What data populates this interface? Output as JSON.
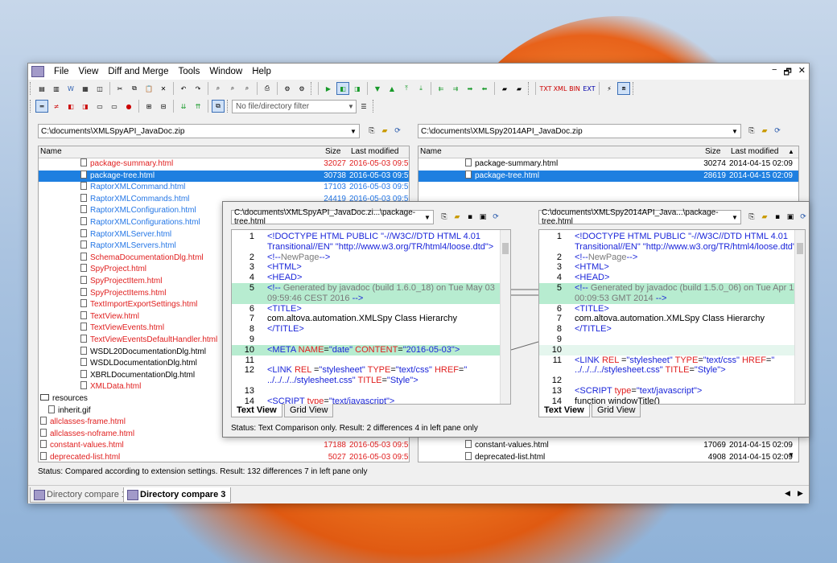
{
  "menu": [
    "File",
    "View",
    "Diff and Merge",
    "Tools",
    "Window",
    "Help"
  ],
  "window_controls": [
    "−",
    "🗗",
    "✕"
  ],
  "filter_placeholder": "No file/directory filter",
  "left_path": "C:\\documents\\XMLSpyAPI_JavaDoc.zip",
  "right_path": "C:\\documents\\XMLSpy2014API_JavaDoc.zip",
  "columns": {
    "name": "Name",
    "size": "Size",
    "modified": "Last modified"
  },
  "left_rows": [
    {
      "name": "package-summary.html",
      "size": "32027",
      "date": "2016-05-03 09:59",
      "color": "red",
      "indent": 1
    },
    {
      "name": "package-tree.html",
      "size": "30738",
      "date": "2016-05-03 09:59",
      "color": "sel",
      "indent": 1
    },
    {
      "name": "RaptorXMLCommand.html",
      "size": "17103",
      "date": "2016-05-03 09:59",
      "color": "blue",
      "indent": 1
    },
    {
      "name": "RaptorXMLCommands.html",
      "size": "24419",
      "date": "2016-05-03 09:59",
      "color": "blue",
      "indent": 1
    },
    {
      "name": "RaptorXMLConfiguration.html",
      "size": "",
      "date": "",
      "color": "blue",
      "indent": 1
    },
    {
      "name": "RaptorXMLConfigurations.html",
      "size": "",
      "date": "",
      "color": "blue",
      "indent": 1
    },
    {
      "name": "RaptorXMLServer.html",
      "size": "",
      "date": "",
      "color": "blue",
      "indent": 1
    },
    {
      "name": "RaptorXMLServers.html",
      "size": "",
      "date": "",
      "color": "blue",
      "indent": 1
    },
    {
      "name": "SchemaDocumentationDlg.html",
      "size": "",
      "date": "",
      "color": "red",
      "indent": 1
    },
    {
      "name": "SpyProject.html",
      "size": "",
      "date": "",
      "color": "red",
      "indent": 1
    },
    {
      "name": "SpyProjectItem.html",
      "size": "",
      "date": "",
      "color": "red",
      "indent": 1
    },
    {
      "name": "SpyProjectItems.html",
      "size": "",
      "date": "",
      "color": "red",
      "indent": 1
    },
    {
      "name": "TextImportExportSettings.html",
      "size": "",
      "date": "",
      "color": "red",
      "indent": 1
    },
    {
      "name": "TextView.html",
      "size": "",
      "date": "",
      "color": "red",
      "indent": 1
    },
    {
      "name": "TextViewEvents.html",
      "size": "",
      "date": "",
      "color": "red",
      "indent": 1
    },
    {
      "name": "TextViewEventsDefaultHandler.html",
      "size": "",
      "date": "",
      "color": "red",
      "indent": 1
    },
    {
      "name": "WSDL20DocumentationDlg.html",
      "size": "",
      "date": "",
      "color": "blk",
      "indent": 1
    },
    {
      "name": "WSDLDocumentationDlg.html",
      "size": "",
      "date": "",
      "color": "blk",
      "indent": 1
    },
    {
      "name": "XBRLDocumentationDlg.html",
      "size": "",
      "date": "",
      "color": "blk",
      "indent": 1
    },
    {
      "name": "XMLData.html",
      "size": "",
      "date": "",
      "color": "red",
      "indent": 1
    },
    {
      "name": "resources",
      "size": "",
      "date": "",
      "color": "dir",
      "indent": 0
    },
    {
      "name": "inherit.gif",
      "size": "",
      "date": "",
      "color": "blk",
      "indent": 0.5
    },
    {
      "name": "allclasses-frame.html",
      "size": "",
      "date": "",
      "color": "red",
      "indent": 0
    },
    {
      "name": "allclasses-noframe.html",
      "size": "",
      "date": "",
      "color": "red",
      "indent": 0
    },
    {
      "name": "constant-values.html",
      "size": "17188",
      "date": "2016-05-03 09:59",
      "color": "red",
      "indent": 0
    },
    {
      "name": "deprecated-list.html",
      "size": "5027",
      "date": "2016-05-03 09:59",
      "color": "red",
      "indent": 0
    }
  ],
  "right_rows": [
    {
      "name": "package-summary.html",
      "size": "30274",
      "date": "2014-04-15 02:09",
      "color": "blk"
    },
    {
      "name": "package-tree.html",
      "size": "28619",
      "date": "2014-04-15 02:09",
      "color": "sel"
    },
    {
      "name": "constant-values.html",
      "size": "17069",
      "date": "2014-04-15 02:09",
      "color": "blk"
    },
    {
      "name": "deprecated-list.html",
      "size": "4908",
      "date": "2014-04-15 02:09",
      "color": "blk"
    }
  ],
  "dir_status": "Status: Compared according to extension settings. Result: 132 differences 7 in left pane only",
  "tabs": [
    "Directory compare 1",
    "Directory compare 3"
  ],
  "text_compare": {
    "left_path": "C:\\documents\\XMLSpyAPI_JavaDoc.zi...\\package-tree.html",
    "right_path": "C:\\documents\\XMLSpy2014API_Java...\\package-tree.html",
    "view_tabs": [
      "Text View",
      "Grid View"
    ],
    "status": "Status: Text Comparison only. Result: 2 differences 4 in left pane only",
    "left_lines": [
      {
        "n": "1",
        "html": "<span class='tag'>&lt;!DOCTYPE HTML PUBLIC \"-//W3C//DTD HTML 4.01</span>"
      },
      {
        "n": "",
        "html": "<span class='tag'>Transitional//EN\" \"http://www.w3.org/TR/html4/loose.dtd\"&gt;</span>"
      },
      {
        "n": "2",
        "html": "<span class='tag'>&lt;!--</span><span class='cmt'>NewPage</span><span class='tag'>--&gt;</span>"
      },
      {
        "n": "3",
        "html": "<span class='tag'>&lt;HTML&gt;</span>"
      },
      {
        "n": "4",
        "html": "<span class='tag'>&lt;HEAD&gt;</span>"
      },
      {
        "n": "5",
        "html": "<span class='tag'>&lt;!--</span><span class='cmt'> Generated by javadoc (build 1.6.0_18) on Tue May 03</span>",
        "diff": true
      },
      {
        "n": "",
        "html": "<span class='cmt'>09:59:46 CEST 2016 </span><span class='tag'>--&gt;</span>",
        "diff": true
      },
      {
        "n": "6",
        "html": "<span class='tag'>&lt;TITLE&gt;</span>"
      },
      {
        "n": "7",
        "html": "com.altova.automation.XMLSpy Class Hierarchy"
      },
      {
        "n": "8",
        "html": "<span class='tag'>&lt;/TITLE&gt;</span>"
      },
      {
        "n": "9",
        "html": ""
      },
      {
        "n": "10",
        "html": "<span class='tag'>&lt;META </span><span class='att'>NAME</span>=<span class='val'>\"date\"</span> <span class='att'>CONTENT</span>=<span class='val'>\"2016-05-03\"</span><span class='tag'>&gt;</span>",
        "diff": true
      },
      {
        "n": "11",
        "html": ""
      },
      {
        "n": "12",
        "html": "<span class='tag'>&lt;LINK </span><span class='att'>REL</span> =<span class='val'>\"stylesheet\"</span> <span class='att'>TYPE</span>=<span class='val'>\"text/css\"</span> <span class='att'>HREF</span>=<span class='val'>\"</span>"
      },
      {
        "n": "",
        "html": "<span class='val'>../../../../stylesheet.css\"</span> <span class='att'>TITLE</span>=<span class='val'>\"Style\"</span><span class='tag'>&gt;</span>"
      },
      {
        "n": "13",
        "html": ""
      },
      {
        "n": "14",
        "html": "<span class='tag'>&lt;SCRIPT </span><span class='att'>type</span>=<span class='val'>\"text/javascript\"</span><span class='tag'>&gt;</span>"
      }
    ],
    "right_lines": [
      {
        "n": "1",
        "html": "<span class='tag'>&lt;!DOCTYPE HTML PUBLIC \"-//W3C//DTD HTML 4.01</span>"
      },
      {
        "n": "",
        "html": "<span class='tag'>Transitional//EN\" \"http://www.w3.org/TR/html4/loose.dtd\"&gt;</span>"
      },
      {
        "n": "2",
        "html": "<span class='tag'>&lt;!--</span><span class='cmt'>NewPage</span><span class='tag'>--&gt;</span>"
      },
      {
        "n": "3",
        "html": "<span class='tag'>&lt;HTML&gt;</span>"
      },
      {
        "n": "4",
        "html": "<span class='tag'>&lt;HEAD&gt;</span>"
      },
      {
        "n": "5",
        "html": "<span class='tag'>&lt;!--</span><span class='cmt'> Generated by javadoc (build 1.5.0_06) on Tue Apr 15</span>",
        "diff": true
      },
      {
        "n": "",
        "html": "<span class='cmt'>00:09:53 GMT 2014 </span><span class='tag'>--&gt;</span>",
        "diff": true
      },
      {
        "n": "6",
        "html": "<span class='tag'>&lt;TITLE&gt;</span>"
      },
      {
        "n": "7",
        "html": "com.altova.automation.XMLSpy Class Hierarchy"
      },
      {
        "n": "8",
        "html": "<span class='tag'>&lt;/TITLE&gt;</span>"
      },
      {
        "n": "9",
        "html": ""
      },
      {
        "n": "10",
        "html": "",
        "hl": true
      },
      {
        "n": "11",
        "html": "<span class='tag'>&lt;LINK </span><span class='att'>REL</span> =<span class='val'>\"stylesheet\"</span> <span class='att'>TYPE</span>=<span class='val'>\"text/css\"</span> <span class='att'>HREF</span>=<span class='val'>\"</span>"
      },
      {
        "n": "",
        "html": "<span class='val'>../../../../stylesheet.css\"</span> <span class='att'>TITLE</span>=<span class='val'>\"Style\"</span><span class='tag'>&gt;</span>"
      },
      {
        "n": "12",
        "html": ""
      },
      {
        "n": "13",
        "html": "<span class='tag'>&lt;SCRIPT </span><span class='att'>type</span>=<span class='val'>\"text/javascript\"</span><span class='tag'>&gt;</span>"
      },
      {
        "n": "14",
        "html": "function windowTitle()"
      }
    ]
  }
}
